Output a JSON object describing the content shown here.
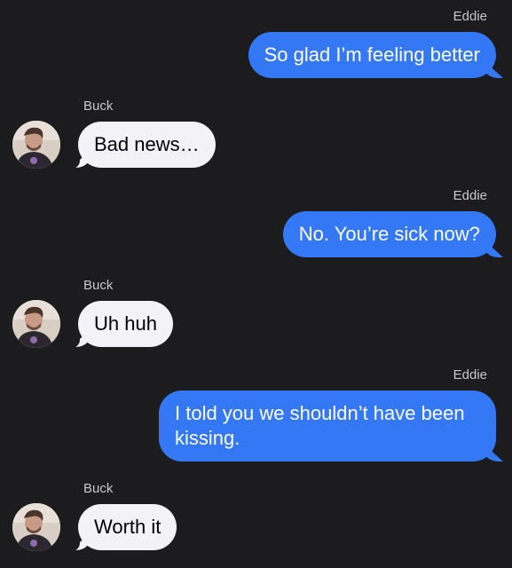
{
  "conversation": {
    "messages": [
      {
        "direction": "outgoing",
        "sender": "Eddie",
        "text": "So glad I’m feeling better"
      },
      {
        "direction": "incoming",
        "sender": "Buck",
        "text": "Bad news…"
      },
      {
        "direction": "outgoing",
        "sender": "Eddie",
        "text": "No. You’re sick now?"
      },
      {
        "direction": "incoming",
        "sender": "Buck",
        "text": "Uh huh"
      },
      {
        "direction": "outgoing",
        "sender": "Eddie",
        "text": "I told you we shouldn’t have been kissing."
      },
      {
        "direction": "incoming",
        "sender": "Buck",
        "text": "Worth it"
      }
    ]
  },
  "colors": {
    "background": "#1c1c1e",
    "outgoing_bubble": "#3478f6",
    "incoming_bubble": "#f2f2f7",
    "sender_label": "#c7c7cc"
  },
  "icons": {
    "avatar": "buck-avatar-photo"
  }
}
